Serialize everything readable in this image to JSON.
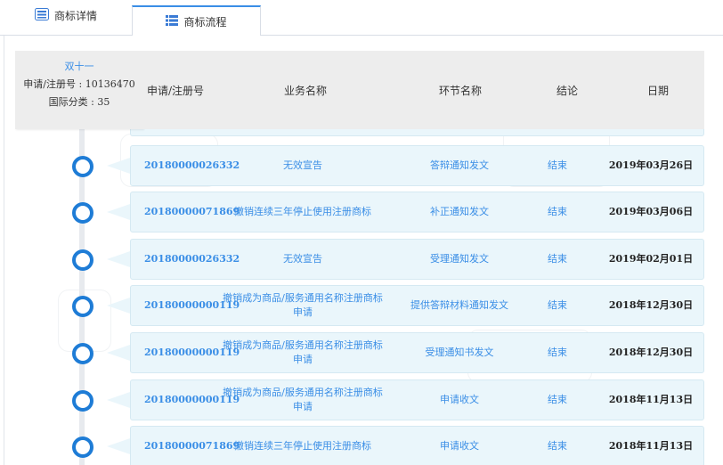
{
  "tabs": [
    {
      "label": "商标详情"
    },
    {
      "label": "商标流程"
    }
  ],
  "trademark": {
    "name": "双十一",
    "reg_line": "申请/注册号 : 10136470",
    "class_line": "国际分类 : 35"
  },
  "columns": {
    "reg_no": "申请/注册号",
    "business": "业务名称",
    "step": "环节名称",
    "conclusion": "结论",
    "date": "日期"
  },
  "rows": [
    {
      "reg_no": "20180000026332",
      "business": "无效宣告",
      "step": "答辩通知发文",
      "conclusion": "结束",
      "date": "2019年03月26日"
    },
    {
      "reg_no": "20180000071869",
      "business": "撤销连续三年停止使用注册商标",
      "step": "补正通知发文",
      "conclusion": "结束",
      "date": "2019年03月06日"
    },
    {
      "reg_no": "20180000026332",
      "business": "无效宣告",
      "step": "受理通知发文",
      "conclusion": "结束",
      "date": "2019年02月01日"
    },
    {
      "reg_no": "20180000000119",
      "business": "撤销成为商品/服务通用名称注册商标申请",
      "step": "提供答辩材料通知发文",
      "conclusion": "结束",
      "date": "2018年12月30日"
    },
    {
      "reg_no": "20180000000119",
      "business": "撤销成为商品/服务通用名称注册商标申请",
      "step": "受理通知书发文",
      "conclusion": "结束",
      "date": "2018年12月30日"
    },
    {
      "reg_no": "20180000000119",
      "business": "撤销成为商品/服务通用名称注册商标申请",
      "step": "申请收文",
      "conclusion": "结束",
      "date": "2018年11月13日"
    },
    {
      "reg_no": "20180000071869",
      "business": "撤销连续三年停止使用注册商标",
      "step": "申请收文",
      "conclusion": "结束",
      "date": "2018年11月13日"
    }
  ],
  "colors": {
    "accent": "#3a8ee6",
    "timeline": "#1e7cd6",
    "card_bg": "#eaf6fb",
    "header_bg": "#ededed"
  }
}
